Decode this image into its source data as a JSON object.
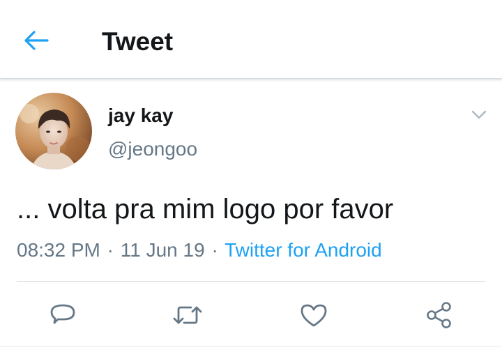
{
  "header": {
    "title": "Tweet",
    "back_icon": "arrow-left-icon",
    "accent_color": "#1da1f2"
  },
  "tweet": {
    "display_name": "jay kay",
    "handle": "@jeongoo",
    "text": "... volta pra mim logo por favor",
    "time": "08:32 PM",
    "date": "11 Jun 19",
    "source": "Twitter for Android",
    "separator": "·",
    "menu_icon": "chevron-down-icon"
  },
  "actions": [
    {
      "icon": "reply-icon"
    },
    {
      "icon": "retweet-icon"
    },
    {
      "icon": "like-icon"
    },
    {
      "icon": "share-icon"
    }
  ],
  "colors": {
    "text_primary": "#14171a",
    "text_secondary": "#657786",
    "link": "#1da1f2",
    "divider": "#d6dde3"
  }
}
